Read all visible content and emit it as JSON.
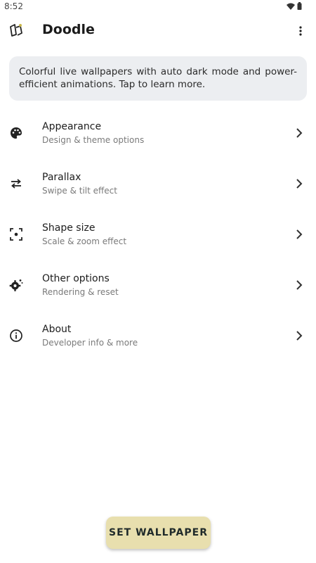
{
  "status_bar": {
    "time": "8:52",
    "icons": [
      "wifi-icon",
      "battery-icon"
    ]
  },
  "app_bar": {
    "title": "Doodle",
    "logo_icon": "doodle-logo-icon",
    "menu_icon": "more-vert-icon"
  },
  "intro": {
    "text": "Colorful live wallpapers with auto dark mode and power-efficient animations. Tap to learn more."
  },
  "menu": {
    "items": [
      {
        "icon": "palette-icon",
        "title": "Appearance",
        "subtitle": "Design & theme options"
      },
      {
        "icon": "swap-arrows-icon",
        "title": "Parallax",
        "subtitle": "Swipe & tilt effect"
      },
      {
        "icon": "center-focus-icon",
        "title": "Shape size",
        "subtitle": "Scale & zoom effect"
      },
      {
        "icon": "settings-gear-icon",
        "title": "Other options",
        "subtitle": "Rendering & reset"
      },
      {
        "icon": "info-icon",
        "title": "About",
        "subtitle": "Developer info & more"
      }
    ]
  },
  "fab": {
    "label": "SET WALLPAPER",
    "color": "#e8dfae"
  }
}
